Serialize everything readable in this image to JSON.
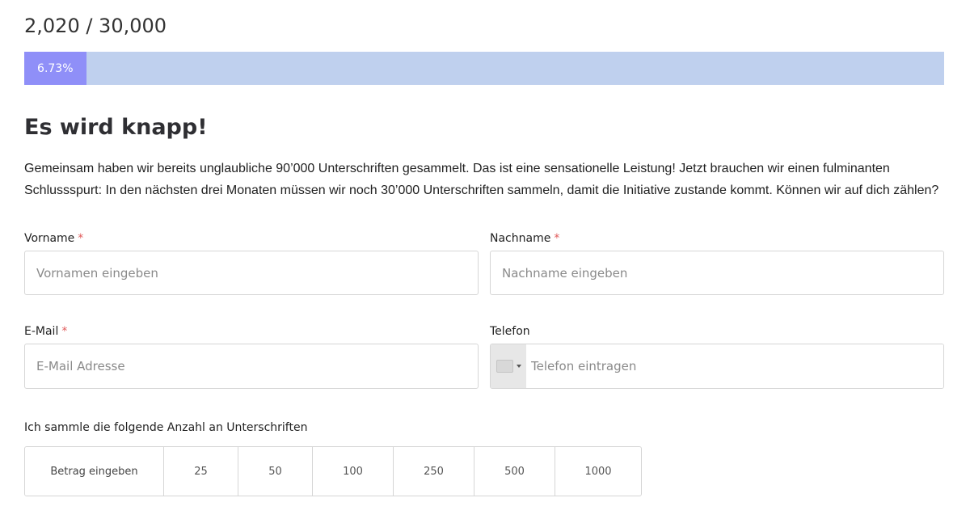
{
  "progress": {
    "count_text": "2,020 / 30,000",
    "percent_label": "6.73%",
    "fraction": 0.0673,
    "fill_color": "#8f8ff8",
    "track_color": "#bfd0ee"
  },
  "heading": "Es wird knapp!",
  "intro": "Gemeinsam haben wir bereits unglaubliche 90’000 Unterschriften gesammelt. Das ist eine sensationelle Leistung! Jetzt brauchen wir einen fulminanten Schlussspurt: In den nächsten drei Monaten müssen wir noch 30’000 Unterschriften sammeln, damit die Initiative zustande kommt. Können wir auf dich zählen?",
  "form": {
    "required_marker": "*",
    "first_name": {
      "label": "Vorname",
      "placeholder": "Vornamen eingeben",
      "value": ""
    },
    "last_name": {
      "label": "Nachname",
      "placeholder": "Nachname eingeben",
      "value": ""
    },
    "email": {
      "label": "E-Mail",
      "placeholder": "E-Mail Adresse",
      "value": ""
    },
    "phone": {
      "label": "Telefon",
      "placeholder": "Telefon eintragen",
      "value": "",
      "country_icon": "flag-icon"
    },
    "signatures": {
      "label": "Ich sammle die folgende Anzahl an Unterschriften",
      "custom_placeholder": "Betrag eingeben",
      "options": [
        "25",
        "50",
        "100",
        "250",
        "500",
        "1000"
      ]
    }
  }
}
